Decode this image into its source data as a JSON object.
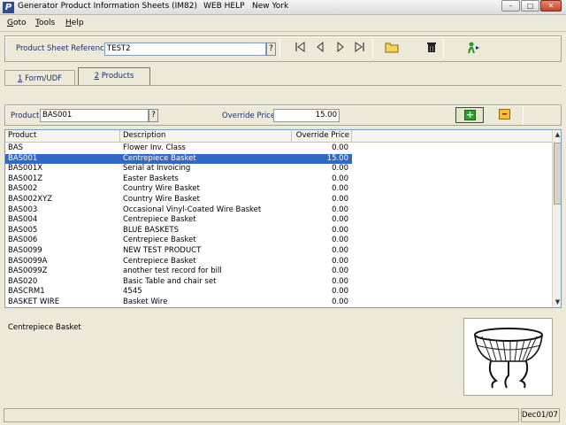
{
  "window": {
    "app_icon": "P",
    "title": "Generator Product Information Sheets (IM82)",
    "help": "WEB HELP",
    "location": "New York",
    "min_glyph": "–",
    "max_glyph": "□",
    "close_glyph": "✕"
  },
  "menu": {
    "goto": {
      "u": "G",
      "rest": "oto"
    },
    "tools": {
      "u": "T",
      "rest": "ools"
    },
    "help": {
      "u": "H",
      "rest": "elp"
    }
  },
  "reference": {
    "label": "Product Sheet Reference",
    "value": "TEST2",
    "lookup": "?"
  },
  "toolbar": {
    "icons": [
      "first-record-icon",
      "previous-record-icon",
      "next-record-icon",
      "last-record-icon",
      "folder-icon",
      "trash-icon",
      "user-add-icon"
    ]
  },
  "tabs": [
    {
      "u": "1",
      "rest": " Form/UDF"
    },
    {
      "u": "2",
      "rest": " Products"
    }
  ],
  "product_entry": {
    "product_label": "Product",
    "product_value": "BAS001",
    "lookup": "?",
    "override_label": "Override Price",
    "override_value": "15.00"
  },
  "grid": {
    "columns": [
      "Product",
      "Description",
      "Override Price"
    ],
    "rows": [
      {
        "product": "BAS",
        "description": "Flower Inv. Class",
        "price": "0.00"
      },
      {
        "product": "BAS001",
        "description": "Centrepiece Basket",
        "price": "15.00"
      },
      {
        "product": "BAS001X",
        "description": "Serial at Invoicing",
        "price": "0.00"
      },
      {
        "product": "BAS001Z",
        "description": "Easter Baskets",
        "price": "0.00"
      },
      {
        "product": "BAS002",
        "description": "Country Wire Basket",
        "price": "0.00"
      },
      {
        "product": "BAS002XYZ",
        "description": "Country Wire Basket",
        "price": "0.00"
      },
      {
        "product": "BAS003",
        "description": "Occasional Vinyl-Coated Wire Basket",
        "price": "0.00"
      },
      {
        "product": "BAS004",
        "description": "Centrepiece Basket",
        "price": "0.00"
      },
      {
        "product": "BAS005",
        "description": "BLUE BASKETS",
        "price": "0.00"
      },
      {
        "product": "BAS006",
        "description": "Centrepiece Basket",
        "price": "0.00"
      },
      {
        "product": "BAS0099",
        "description": "NEW TEST PRODUCT",
        "price": "0.00"
      },
      {
        "product": "BAS0099A",
        "description": "Centrepiece Basket",
        "price": "0.00"
      },
      {
        "product": "BAS0099Z",
        "description": "another test record for bill",
        "price": "0.00"
      },
      {
        "product": "BAS020",
        "description": "Basic Table and chair set",
        "price": "0.00"
      },
      {
        "product": "BASCRM1",
        "description": "4545",
        "price": "0.00"
      },
      {
        "product": "BASKET WIRE",
        "description": "Basket Wire",
        "price": "0.00"
      }
    ],
    "selected_index": 1
  },
  "detail": {
    "description": "Centrepiece Basket"
  },
  "status": {
    "main": "",
    "date": "Dec01/07"
  },
  "colors": {
    "selection": "#316ac5",
    "background": "#ece9d8",
    "label": "#1a2e6e"
  }
}
